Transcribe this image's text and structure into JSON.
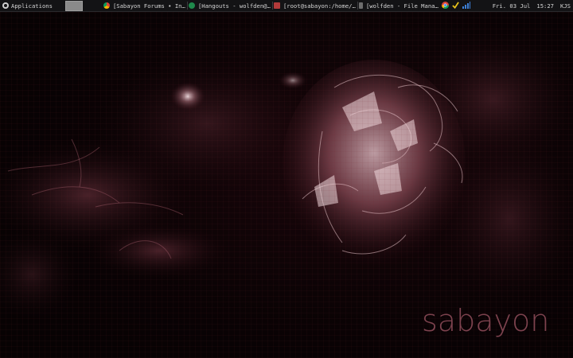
{
  "panel": {
    "apps_label": "Applications",
    "tasks": [
      {
        "icon": "chrome-icon",
        "label": "[Sabayon Forums • In…"
      },
      {
        "icon": "hangouts-icon",
        "label": "[Hangouts - wolfden@…"
      },
      {
        "icon": "terminal-icon",
        "label": "[root@sabayon:/home/…"
      },
      {
        "icon": "file-manager-icon",
        "label": "[wolfden - File Mana…"
      }
    ],
    "tray_icons": [
      "chrome-tray-icon",
      "check-tray-icon",
      "network-signal-icon"
    ],
    "clock": {
      "date": "Fri. 03 Jul",
      "time": "15:27",
      "user": "KJS"
    }
  },
  "wallpaper": {
    "brand_text": "sabayon",
    "accent": "#8a4a57",
    "flower_color": "#c99aa3"
  }
}
